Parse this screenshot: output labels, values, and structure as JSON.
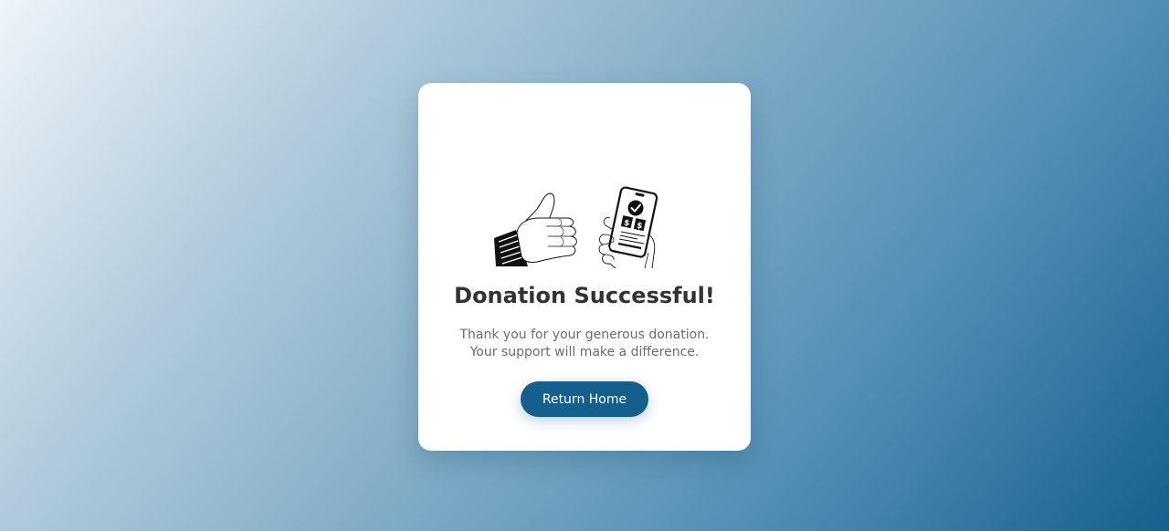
{
  "card": {
    "title": "Donation Successful!",
    "message": "Thank you for your generous donation. Your support will make a difference.",
    "button_label": "Return Home",
    "illustration": {
      "icons": [
        "thumbs-up-hand-icon",
        "phone-payment-icon"
      ],
      "phone_symbols": [
        "$",
        "$"
      ]
    }
  },
  "colors": {
    "background_start": "#eef4fa",
    "background_end": "#15618f",
    "button": "#145f8e",
    "title": "#333333",
    "message": "#6b6b6b"
  }
}
